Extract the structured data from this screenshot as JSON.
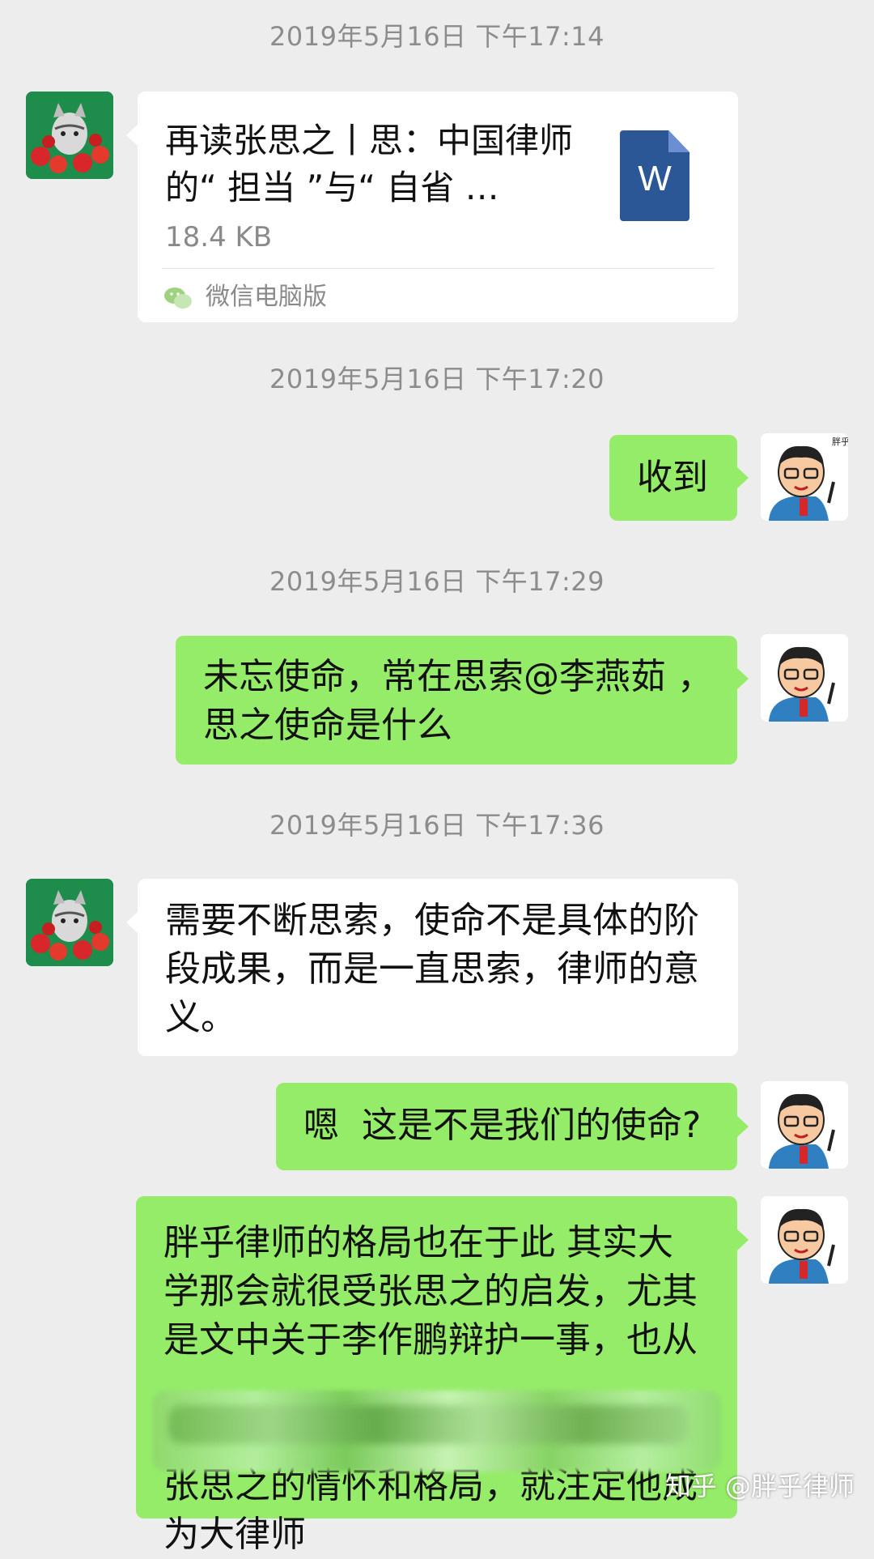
{
  "messages": [
    {
      "type": "timestamp",
      "text": "2019年5月16日 下午17:14"
    },
    {
      "type": "file",
      "sender": "contact",
      "title": "再读张思之丨思：中国律师的“ 担当 ”与“ 自省 …",
      "size": "18.4 KB",
      "source": "微信电脑版",
      "file_icon_letter": "W",
      "file_icon": "word-doc-icon"
    },
    {
      "type": "timestamp",
      "text": "2019年5月16日 下午17:20"
    },
    {
      "type": "text",
      "sender": "self",
      "text": "收到"
    },
    {
      "type": "timestamp",
      "text": "2019年5月16日 下午17:29"
    },
    {
      "type": "text",
      "sender": "self",
      "line1": "未忘使命，常在思索@李燕茹 ，",
      "line2": "思之使命是什么"
    },
    {
      "type": "timestamp",
      "text": "2019年5月16日 下午17:36"
    },
    {
      "type": "text",
      "sender": "contact",
      "line1": "需要不断思索，使命不是具体的阶",
      "line2": "段成果，而是一直思索，律师的意",
      "line3": "义。"
    },
    {
      "type": "text",
      "sender": "self",
      "text": "嗯  这是不是我们的使命?"
    },
    {
      "type": "text",
      "sender": "self",
      "line1": "胖乎律师的格局也在于此  其实大",
      "line2": "学那会就很受张思之的启发，尤其",
      "line3": "是文中关于李作鹏辩护一事，也从",
      "line5": "张思之的情怀和格局，就注定他成",
      "line6": "为大律师"
    }
  ],
  "avatars": {
    "contact": "cat-avatar",
    "self": "lawyer-cartoon-avatar",
    "self_caption": "胖乎律师"
  },
  "watermark": "知乎 @胖乎律师",
  "colors": {
    "background": "#ededed",
    "self_bubble": "#95ec69",
    "contact_bubble": "#ffffff",
    "timestamp": "#8c8c8c"
  }
}
